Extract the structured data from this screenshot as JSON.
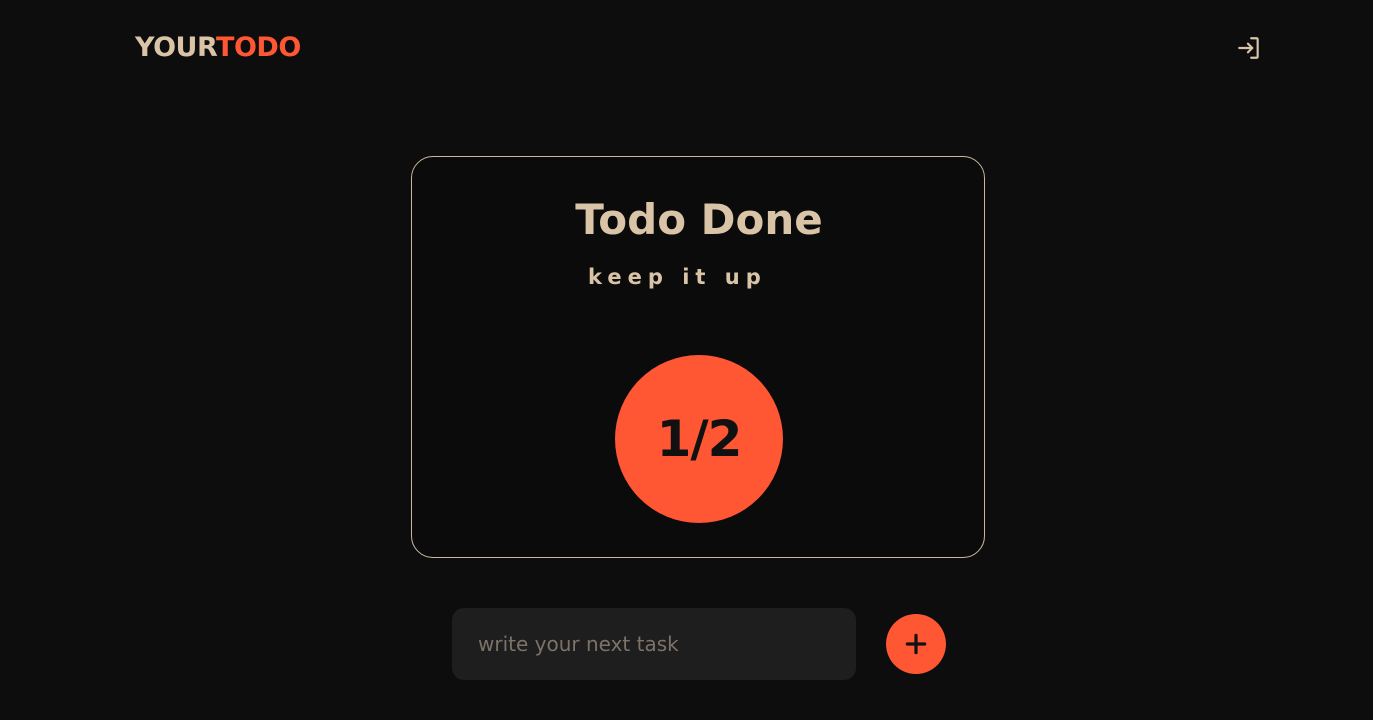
{
  "header": {
    "logo_part1": "YOUR",
    "logo_part2": "TODO",
    "login_icon": "login-icon"
  },
  "summary": {
    "title": "Todo Done",
    "subtitle": "keep it up",
    "progress": "1/2"
  },
  "new_task": {
    "placeholder": "write your next task",
    "value": "",
    "add_icon": "plus-icon"
  },
  "colors": {
    "background": "#0d0d0d",
    "accent": "#ff5733",
    "text": "#d9c4a8",
    "input_bg": "#1e1e1e"
  }
}
